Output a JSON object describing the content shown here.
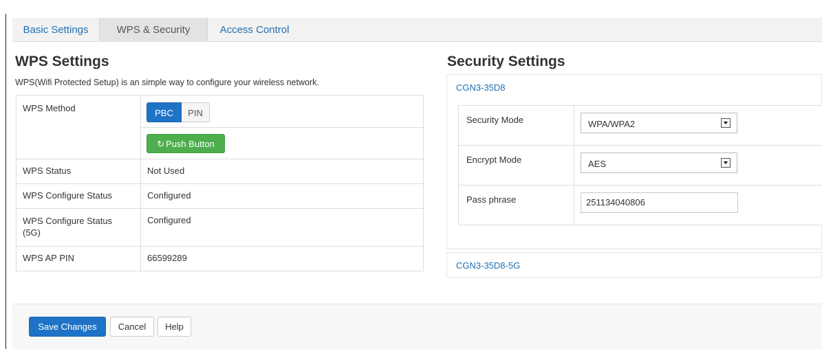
{
  "caption": {
    "text_visible_part": "",
    "accent_part": ""
  },
  "tabs": [
    {
      "label": "Basic Settings",
      "active": false
    },
    {
      "label": "WPS & Security",
      "active": true
    },
    {
      "label": "Access Control",
      "active": false
    }
  ],
  "wps": {
    "title": "WPS Settings",
    "description": "WPS(Wifi Protected Setup) is an simple way to configure your wireless network.",
    "method_label": "WPS Method",
    "method_options": {
      "pbc": "PBC",
      "pin": "PIN",
      "selected": "PBC"
    },
    "push_button_label": "Push Button",
    "push_button_icon": "refresh-icon",
    "rows": [
      {
        "label": "WPS Status",
        "value": "Not Used"
      },
      {
        "label": "WPS Configure Status",
        "value": "Configured"
      },
      {
        "label": "WPS Configure Status (5G)",
        "value": "Configured"
      },
      {
        "label": "WPS AP PIN",
        "value": "66599289"
      }
    ]
  },
  "security": {
    "title": "Security Settings",
    "networks": [
      {
        "ssid": "CGN3-35D8",
        "expanded": true,
        "fields": {
          "security_mode": {
            "label": "Security Mode",
            "value": "WPA/WPA2"
          },
          "encrypt_mode": {
            "label": "Encrypt Mode",
            "value": "AES"
          },
          "pass_phrase": {
            "label": "Pass phrase",
            "value": "251134040806"
          }
        }
      },
      {
        "ssid": "CGN3-35D8-5G",
        "expanded": false
      }
    ]
  },
  "footer": {
    "save_label": "Save Changes",
    "cancel_label": "Cancel",
    "help_label": "Help"
  },
  "colors": {
    "link_blue": "#1f6fb2",
    "primary_blue": "#1f73c6",
    "success_green": "#4cae4c"
  }
}
